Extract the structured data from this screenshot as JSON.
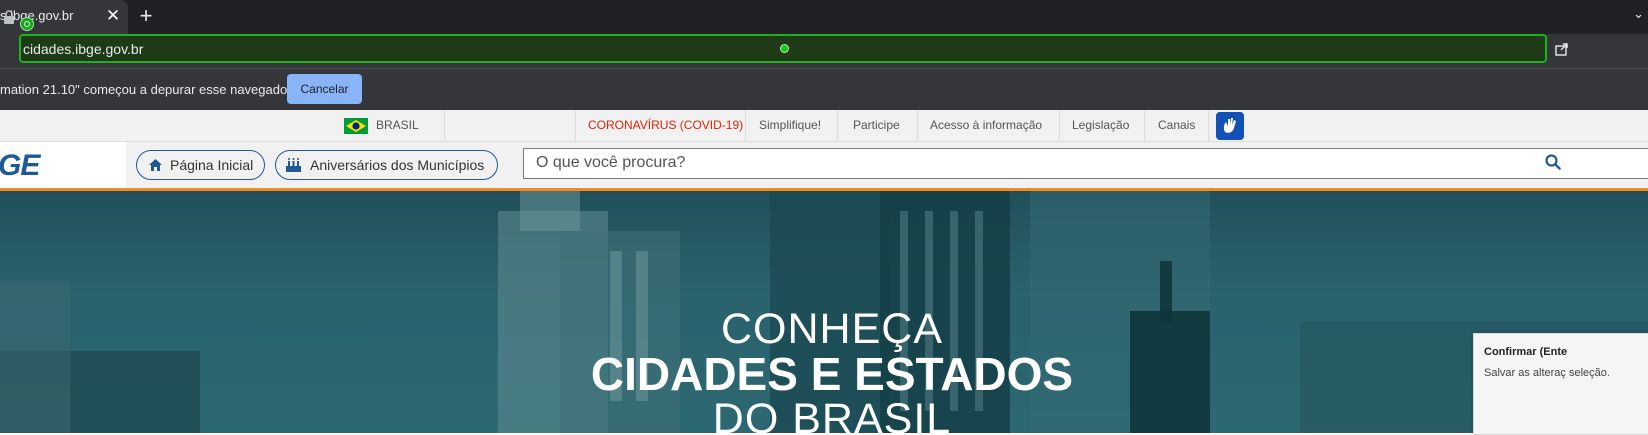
{
  "browser": {
    "tab_title": "s.ibge.gov.br",
    "url": "cidades.ibge.gov.br",
    "debug_message": "mation 21.10\" começou a depurar esse navegador",
    "cancel_label": "Cancelar",
    "new_tab_icon": "plus-icon",
    "close_icon": "close-icon"
  },
  "gov_bar": {
    "country": "BRASIL",
    "links": [
      "CORONAVÍRUS (COVID-19)",
      "Simplifique!",
      "Participe",
      "Acesso à informação",
      "Legislação",
      "Canais"
    ],
    "covid_color": "#e52207"
  },
  "header": {
    "logo_text": "GE",
    "nav": [
      {
        "label": "Página Inicial",
        "icon": "home-icon"
      },
      {
        "label": "Aniversários dos Municípios",
        "icon": "cake-icon"
      }
    ],
    "search_placeholder": "O que você procura?",
    "accent_color": "#1f5a96",
    "stripe_color": "#f08a24"
  },
  "hero": {
    "line1": "CONHEÇA",
    "line2": "CIDADES E ESTADOS",
    "line3": "DO BRASIL"
  },
  "confirm_popup": {
    "title": "Confirmar (Ente",
    "body": "Salvar as alteraç seleção."
  }
}
